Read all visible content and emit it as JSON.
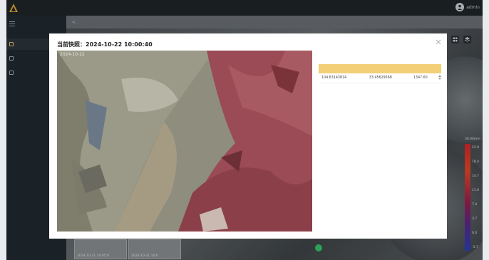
{
  "app": {
    "title": ""
  },
  "user": {
    "name": "admin"
  },
  "sidebar": {
    "items": [
      {
        "label": ""
      },
      {
        "label": ""
      },
      {
        "label": ""
      }
    ]
  },
  "breadcrumb": {
    "text": ""
  },
  "map": {
    "scale_top": "30.00mm",
    "scale_labels": [
      "22.0",
      "18.4",
      "14.7",
      "11.0",
      "7.4",
      "3.7",
      "0.0",
      "-3.7"
    ],
    "thumbnails": [
      {
        "time": "2024-10-21 10:05:0"
      },
      {
        "time": "2024-10-21 10:0"
      }
    ]
  },
  "modal": {
    "title": "当前快照：2024-10-22 10:00:40",
    "stamp": "2024-10-22",
    "info_title": "",
    "info_link": "",
    "columns": [
      "",
      "",
      ""
    ],
    "rows": [
      {
        "lon": "104.63143814",
        "lat": "33.45629568",
        "alt": "1347.60"
      }
    ]
  },
  "colors": {
    "topbar": "#1f2529",
    "sidebar": "#222a30",
    "accent": "#e8c46a",
    "table_header": "#f3cf78"
  }
}
